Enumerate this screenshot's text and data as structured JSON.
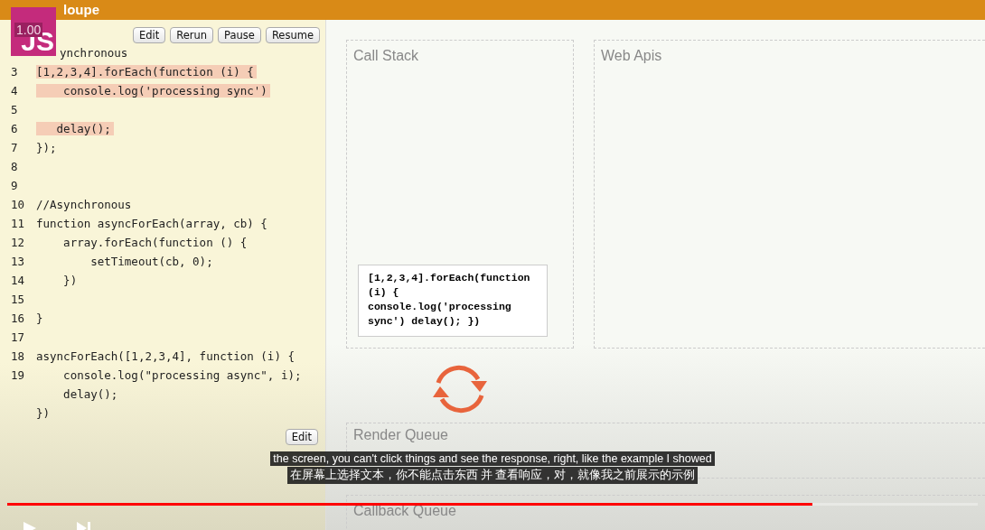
{
  "app": {
    "title": "loupe",
    "badge": "JS",
    "speed": "1.00"
  },
  "editor": {
    "buttons": [
      "Edit",
      "Rerun",
      "Pause",
      "Resume"
    ],
    "bottom_button": "Edit",
    "lines": [
      {
        "text": "ynchronous",
        "highlighted": false
      },
      {
        "number": "3",
        "text": "[1,2,3,4].forEach(function (i) {",
        "highlighted": true
      },
      {
        "number": "4",
        "text": "    console.log('processing sync')",
        "highlighted": true
      },
      {
        "number": "5"
      },
      {
        "number": "6",
        "text": "   delay();",
        "highlighted": true
      },
      {
        "number": "7",
        "text": "});",
        "highlighted": false
      },
      {
        "number": "8"
      },
      {
        "number": "9"
      },
      {
        "number": "10",
        "text": "//Asynchronous",
        "highlighted": false
      },
      {
        "number": "11",
        "text": "function asyncForEach(array, cb) {",
        "highlighted": false
      },
      {
        "number": "12",
        "text": "    array.forEach(function () {",
        "highlighted": false
      },
      {
        "number": "13",
        "text": "        setTimeout(cb, 0);",
        "highlighted": false
      },
      {
        "number": "14",
        "text": "    })",
        "highlighted": false
      },
      {
        "number": "15"
      },
      {
        "number": "16",
        "text": "}",
        "highlighted": false
      },
      {
        "number": "17"
      },
      {
        "number": "18",
        "text": "asyncForEach([1,2,3,4], function (i) {",
        "highlighted": false
      },
      {
        "number": "19",
        "text": "    console.log(\"processing async\", i);",
        "highlighted": false
      },
      {
        "text": "    delay();",
        "highlighted": false
      },
      {
        "text": "})",
        "highlighted": false
      }
    ]
  },
  "call_stack": {
    "title": "Call Stack",
    "frames": [
      "[1,2,3,4].forEach(function (i) { console.log('processing sync') delay(); })"
    ]
  },
  "web_apis": {
    "title": "Web Apis"
  },
  "render_queue": {
    "title": "Render Queue"
  },
  "callback_queue": {
    "title": "Callback Queue"
  },
  "subtitles": [
    "the screen, you can't click things and see the response, right, like the example I showed",
    "在屏幕上选择文本，你不能点击东西 并 查看响应，对，就像我之前展示的示例"
  ],
  "player": {
    "progress": {
      "level": 0.83
    }
  }
}
